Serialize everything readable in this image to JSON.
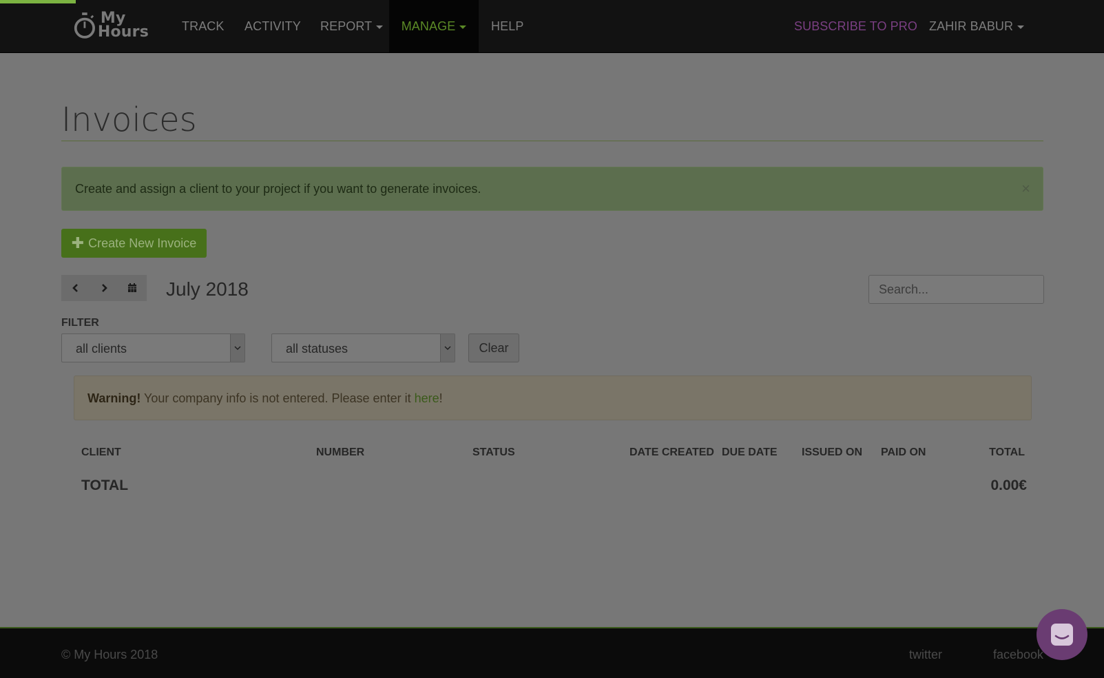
{
  "nav": {
    "logo_line1": "My",
    "logo_line2": "Hours",
    "items": [
      {
        "label": "TRACK"
      },
      {
        "label": "ACTIVITY"
      },
      {
        "label": "REPORT"
      },
      {
        "label": "MANAGE"
      },
      {
        "label": "HELP"
      }
    ],
    "subscribe": "SUBSCRIBE TO PRO",
    "user": "ZAHIR BABUR",
    "active_item": "MANAGE",
    "accent_color": "#5b8a26",
    "subscribe_color": "#7a3f82"
  },
  "page": {
    "title": "Invoices",
    "info_alert": "Create and assign a client to your project if you want to generate invoices.",
    "info_alert_close": "×",
    "create_button": "Create New Invoice",
    "create_button_icon": "plus-icon",
    "period": "July 2018",
    "search_placeholder": "Search...",
    "filter_label": "FILTER",
    "client_filter": "all clients",
    "status_filter": "all statuses",
    "clear_button": "Clear",
    "warning": {
      "strong": "Warning!",
      "text": " Your company info is not entered. Please enter it ",
      "link": "here",
      "suffix": "!"
    }
  },
  "table": {
    "columns": [
      "CLIENT",
      "NUMBER",
      "STATUS",
      "DATE CREATED",
      "DUE DATE",
      "ISSUED ON",
      "PAID ON",
      "TOTAL"
    ],
    "rows": [],
    "total_label": "TOTAL",
    "total_value": "0.00€"
  },
  "footer": {
    "copyright": "© My Hours 2018",
    "links": [
      "twitter",
      "facebook"
    ]
  },
  "icons": {
    "prev": "chevron-left-icon",
    "next": "chevron-right-icon",
    "calendar": "calendar-icon",
    "chat": "chat-icon"
  }
}
